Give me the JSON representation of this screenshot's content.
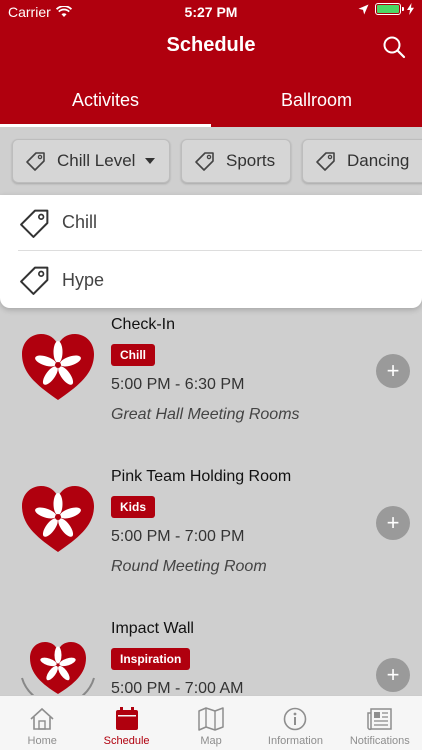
{
  "status_bar": {
    "carrier": "Carrier",
    "time": "5:27 PM"
  },
  "header": {
    "title": "Schedule"
  },
  "tabs": [
    {
      "label": "Activites"
    },
    {
      "label": "Ballroom"
    }
  ],
  "filters": [
    {
      "label": "Chill Level"
    },
    {
      "label": "Sports"
    },
    {
      "label": "Dancing"
    }
  ],
  "dropdown": {
    "options": [
      {
        "label": "Chill"
      },
      {
        "label": "Hype"
      }
    ]
  },
  "events": [
    {
      "name": "Check-In",
      "tag": "Chill",
      "time": "5:00 PM - 6:30 PM",
      "location": "Great Hall Meeting Rooms"
    },
    {
      "name": "Pink Team Holding Room",
      "tag": "Kids",
      "time": "5:00 PM - 7:00 PM",
      "location": "Round Meeting Room"
    },
    {
      "name": "Impact Wall",
      "tag": "Inspiration",
      "time": "5:00 PM - 7:00 AM",
      "location": ""
    }
  ],
  "nav": [
    {
      "label": "Home",
      "icon": "home-icon"
    },
    {
      "label": "Schedule",
      "icon": "calendar-icon"
    },
    {
      "label": "Map",
      "icon": "map-icon"
    },
    {
      "label": "Information",
      "icon": "info-icon"
    },
    {
      "label": "Notifications",
      "icon": "newspaper-icon"
    }
  ],
  "colors": {
    "brand": "#b0000e",
    "background": "#cfcfcf",
    "add_button": "#9a9a9a"
  }
}
